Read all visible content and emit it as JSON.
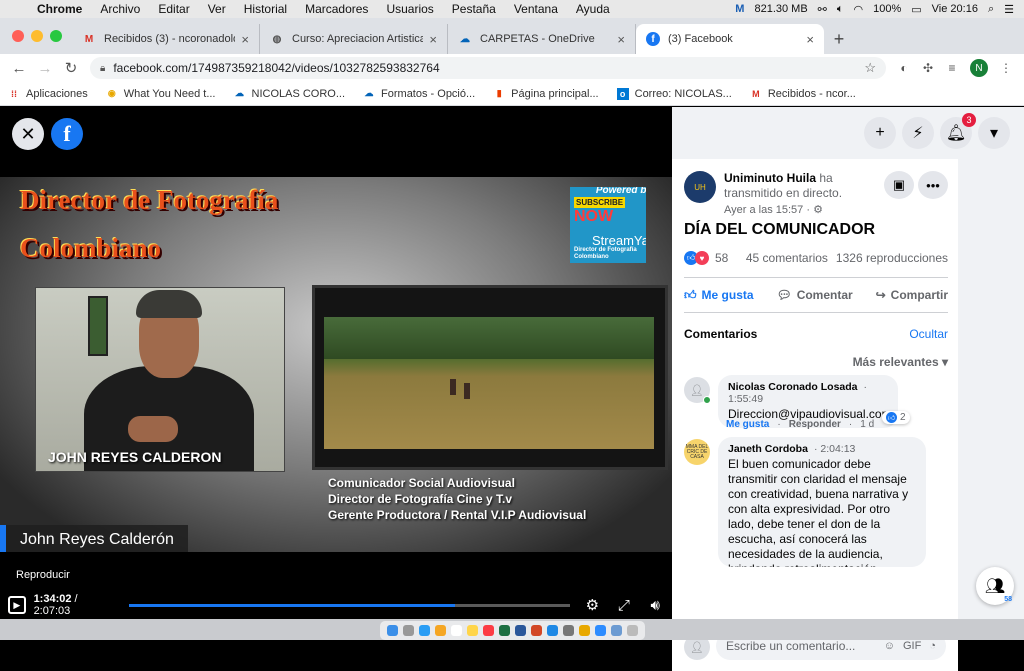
{
  "os_menu": {
    "app": "Chrome",
    "items": [
      "Archivo",
      "Editar",
      "Ver",
      "Historial",
      "Marcadores",
      "Usuarios",
      "Pestaña",
      "Ventana",
      "Ayuda"
    ],
    "memory": "821.30 MB",
    "battery": "100%",
    "clock": "Vie 20:16"
  },
  "tabs": [
    {
      "label": "Recibidos (3) - ncoronadolo@",
      "icon": "gmail-icon",
      "active": false
    },
    {
      "label": "Curso: Apreciacion Artistica",
      "icon": "globe-icon",
      "active": false
    },
    {
      "label": "CARPETAS - OneDrive",
      "icon": "onedrive-icon",
      "active": false
    },
    {
      "label": "(3) Facebook",
      "icon": "facebook-icon",
      "active": true
    }
  ],
  "address": {
    "url": "facebook.com/174987359218042/videos/1032782593832764",
    "profile_initial": "N"
  },
  "bookmarks": [
    {
      "label": "Aplicaciones",
      "icon": "apps-grid-icon"
    },
    {
      "label": "What You Need t...",
      "icon": "chrome-icon"
    },
    {
      "label": "NICOLAS CORO...",
      "icon": "onedrive-icon"
    },
    {
      "label": "Formatos - Opció...",
      "icon": "onedrive-icon"
    },
    {
      "label": "Página principal...",
      "icon": "office-icon"
    },
    {
      "label": "Correo: NICOLAS...",
      "icon": "outlook-icon"
    },
    {
      "label": "Recibidos - ncor...",
      "icon": "gmail-icon"
    }
  ],
  "video": {
    "overlay_title_1": "Director de Fotografía",
    "overlay_title_2": "Colombiano",
    "streamyard": {
      "powered": "Powered by",
      "subscribe": "SUBSCRIBE",
      "now": "NOW",
      "brand": "StreamYard",
      "small": "Director de Fotografía Colombiano"
    },
    "person_name": "JOHN REYES CALDERON",
    "credits": [
      "Comunicador Social Audiovisual",
      "Director de Fotografía Cine y T.v",
      "Gerente Productora / Rental  V.I.P Audiovisual"
    ],
    "lower_third": "John Reyes Calderón",
    "play_label": "Reproducir",
    "current_time": "1:34:02",
    "total_time": "2:07:03",
    "progress_fraction": 0.74
  },
  "post": {
    "page_name": "Uniminuto Huila",
    "action_text": "ha transmitido en directo.",
    "date": "Ayer a las 15:57 · ⚙",
    "title": "DÍA DEL COMUNICADOR",
    "reactions_count": "58",
    "comments_count": "45 comentarios",
    "views_count": "1326 reproducciones",
    "like_label": "Me gusta",
    "comment_label": "Comentar",
    "share_label": "Compartir"
  },
  "comments_section": {
    "header": "Comentarios",
    "hide_label": "Ocultar",
    "sort_label": "Más relevantes",
    "comments": [
      {
        "author": "Nicolas Coronado Losada",
        "time": "1:55:49",
        "text": "Direccion@vipaudiovisual.com",
        "like": "Me gusta",
        "reply": "Responder",
        "age": "1 d",
        "reactions": "2"
      },
      {
        "author": "Janeth Cordoba",
        "time": "2:04:13",
        "text": "El buen comunicador debe transmitir con claridad el mensaje con creatividad, buena narrativa y con alta expresividad. Por otro lado, debe tener el don de la escucha, así conocerá las necesidades de la audiencia, brindando retroalimentación utilizando u... Ver"
      }
    ],
    "write_placeholder": "Escribe un comentario...",
    "avatar_text": "MMA DEL CRIC DE CASA"
  },
  "notifications_badge": "3",
  "contacts_count": "58"
}
